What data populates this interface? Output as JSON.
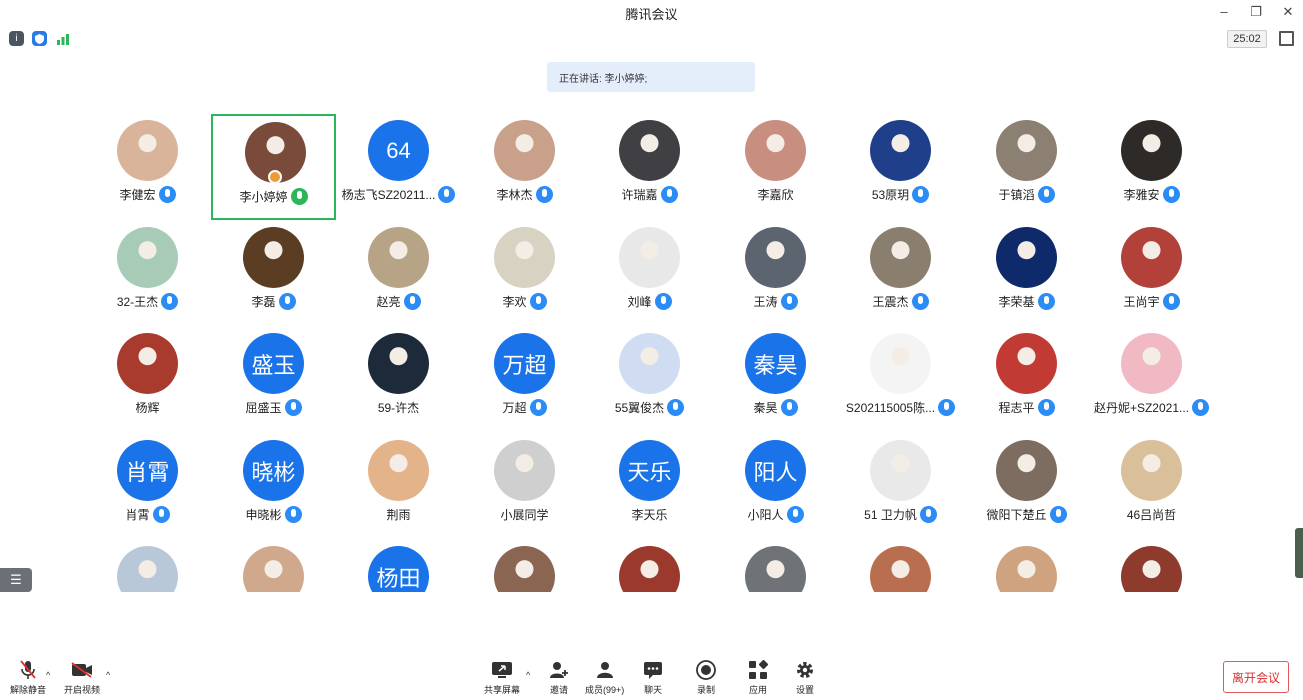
{
  "window": {
    "title": "腾讯会议",
    "timer": "25:02"
  },
  "speaking": "正在讲话: 李小婷婷;",
  "participants": [
    {
      "name": "李健宏",
      "avatar": "photo",
      "color": "#d9b49b",
      "mic": "on"
    },
    {
      "name": "李小婷婷",
      "avatar": "photo",
      "color": "#7a4a3b",
      "mic": "speaking",
      "active": true,
      "host": true
    },
    {
      "name": "杨志飞SZ20211...",
      "avatar": "text",
      "text": "64",
      "mic": "on"
    },
    {
      "name": "李林杰",
      "avatar": "photo",
      "color": "#c9a18a",
      "mic": "on"
    },
    {
      "name": "许瑞嘉",
      "avatar": "photo",
      "color": "#3f3f44",
      "mic": "on"
    },
    {
      "name": "李嘉欣",
      "avatar": "photo",
      "color": "#c88f80",
      "mic": "none"
    },
    {
      "name": "53原玥",
      "avatar": "photo",
      "color": "#1f3f8a",
      "mic": "on"
    },
    {
      "name": "于镇滔",
      "avatar": "photo",
      "color": "#8c8073",
      "mic": "on"
    },
    {
      "name": "李雅安",
      "avatar": "photo",
      "color": "#2d2a28",
      "mic": "on"
    },
    {
      "name": "32-王杰",
      "avatar": "photo",
      "color": "#a8cbb8",
      "mic": "on"
    },
    {
      "name": "李磊",
      "avatar": "photo",
      "color": "#5a3d22",
      "mic": "on"
    },
    {
      "name": "赵亮",
      "avatar": "photo",
      "color": "#b7a486",
      "mic": "on"
    },
    {
      "name": "李欢",
      "avatar": "photo",
      "color": "#d8d2c2",
      "mic": "on"
    },
    {
      "name": "刘峰",
      "avatar": "photo",
      "color": "#e8e8e8",
      "mic": "on"
    },
    {
      "name": "王涛",
      "avatar": "photo",
      "color": "#5c6470",
      "mic": "on"
    },
    {
      "name": "王震杰",
      "avatar": "photo",
      "color": "#8a7f6e",
      "mic": "on"
    },
    {
      "name": "李荣基",
      "avatar": "photo",
      "color": "#0f2a6a",
      "mic": "on"
    },
    {
      "name": "王尚宇",
      "avatar": "photo",
      "color": "#b2413a",
      "mic": "on"
    },
    {
      "name": "杨辉",
      "avatar": "photo",
      "color": "#a93a2e",
      "mic": "none"
    },
    {
      "name": "屈盛玉",
      "avatar": "text",
      "text": "盛玉",
      "mic": "on"
    },
    {
      "name": "59-许杰",
      "avatar": "photo",
      "color": "#1d2a3a",
      "mic": "none"
    },
    {
      "name": "万超",
      "avatar": "text",
      "text": "万超",
      "mic": "on"
    },
    {
      "name": "55翼俊杰",
      "avatar": "photo",
      "color": "#cfdcf2",
      "mic": "on"
    },
    {
      "name": "秦昊",
      "avatar": "text",
      "text": "秦昊",
      "mic": "on"
    },
    {
      "name": "S202115005陈...",
      "avatar": "photo",
      "color": "#f4f4f4",
      "mic": "on"
    },
    {
      "name": "程志平",
      "avatar": "photo",
      "color": "#c23a34",
      "mic": "on"
    },
    {
      "name": "赵丹妮+SZ2021...",
      "avatar": "photo",
      "color": "#f1b9c4",
      "mic": "on"
    },
    {
      "name": "肖霄",
      "avatar": "text",
      "text": "肖霄",
      "mic": "on"
    },
    {
      "name": "申晓彬",
      "avatar": "text",
      "text": "晓彬",
      "mic": "on"
    },
    {
      "name": "荆雨",
      "avatar": "photo",
      "color": "#e3b489",
      "mic": "none"
    },
    {
      "name": "小展同学",
      "avatar": "photo",
      "color": "#cfcfcf",
      "mic": "none"
    },
    {
      "name": "李天乐",
      "avatar": "text",
      "text": "天乐",
      "mic": "none"
    },
    {
      "name": "小阳人",
      "avatar": "text",
      "text": "阳人",
      "mic": "on"
    },
    {
      "name": "51 卫力帆",
      "avatar": "photo",
      "color": "#e9e9e9",
      "mic": "on"
    },
    {
      "name": "微阳下楚丘",
      "avatar": "photo",
      "color": "#7c6d60",
      "mic": "on"
    },
    {
      "name": "46吕尚哲",
      "avatar": "photo",
      "color": "#d9c09a",
      "mic": "none"
    },
    {
      "name": "",
      "avatar": "photo",
      "color": "#b9c8d8",
      "mic": "none"
    },
    {
      "name": "",
      "avatar": "photo",
      "color": "#d0a98c",
      "mic": "none"
    },
    {
      "name": "",
      "avatar": "text",
      "text": "杨田",
      "mic": "none"
    },
    {
      "name": "",
      "avatar": "photo",
      "color": "#8a6552",
      "mic": "none"
    },
    {
      "name": "",
      "avatar": "photo",
      "color": "#9b3a2c",
      "mic": "none"
    },
    {
      "name": "",
      "avatar": "photo",
      "color": "#6f7378",
      "mic": "none"
    },
    {
      "name": "",
      "avatar": "photo",
      "color": "#b86e4f",
      "mic": "none"
    },
    {
      "name": "",
      "avatar": "photo",
      "color": "#cfa37f",
      "mic": "none"
    },
    {
      "name": "",
      "avatar": "photo",
      "color": "#8e3b2e",
      "mic": "none"
    }
  ],
  "toolbar": {
    "unmute": "解除静音",
    "video": "开启视频",
    "share": "共享屏幕",
    "invite": "邀请",
    "members": "成员(99+)",
    "chat": "聊天",
    "record": "录制",
    "apps": "应用",
    "settings": "设置",
    "leave": "离开会议"
  }
}
